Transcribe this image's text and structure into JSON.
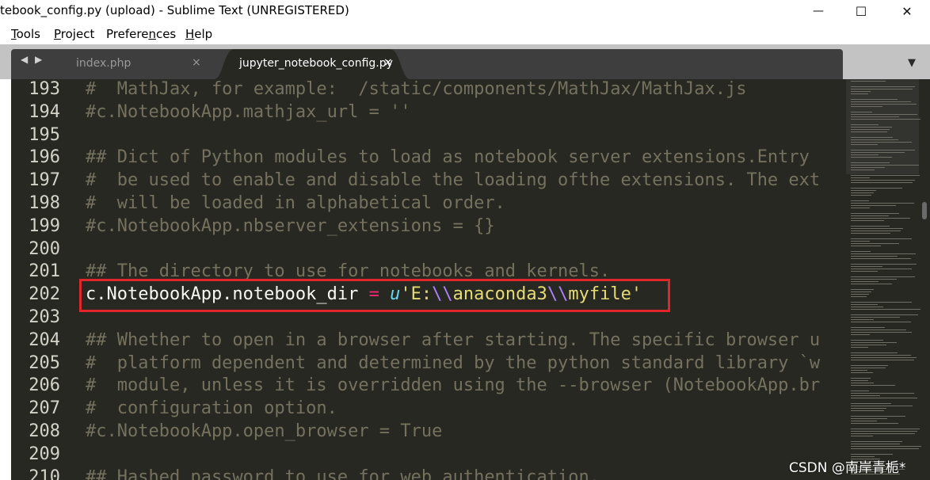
{
  "window": {
    "title": "tebook_config.py (upload) - Sublime Text (UNREGISTERED)",
    "minimize_glyph": "—",
    "maximize_glyph": "☐",
    "close_glyph": "✕"
  },
  "menu": [
    {
      "accel": "T",
      "rest": "ools"
    },
    {
      "accel": "P",
      "rest": "roject"
    },
    {
      "before": "Prefere",
      "accel": "n",
      "rest": "ces"
    },
    {
      "accel": "H",
      "rest": "elp"
    }
  ],
  "tabs": {
    "nav_left_glyph": "◀",
    "nav_right_glyph": "▶",
    "items": [
      {
        "label": "index.php",
        "close": "×",
        "active": false
      },
      {
        "label": "jupyter_notebook_config.py",
        "close": "×",
        "active": true
      }
    ],
    "menu_glyph": "▼"
  },
  "editor": {
    "lines": [
      {
        "num": "193",
        "text": "#  MathJax, for example:  /static/components/MathJax/MathJax.js"
      },
      {
        "num": "194",
        "text": "#c.NotebookApp.mathjax_url = ''"
      },
      {
        "num": "195",
        "text": ""
      },
      {
        "num": "196",
        "text": "## Dict of Python modules to load as notebook server extensions.Entry"
      },
      {
        "num": "197",
        "text": "#  be used to enable and disable the loading ofthe extensions. The ext"
      },
      {
        "num": "198",
        "text": "#  will be loaded in alphabetical order."
      },
      {
        "num": "199",
        "text": "#c.NotebookApp.nbserver_extensions = {}"
      },
      {
        "num": "200",
        "text": ""
      },
      {
        "num": "201",
        "text": "## The directory to use for notebooks and kernels."
      },
      {
        "num": "202",
        "text": ""
      },
      {
        "num": "203",
        "text": ""
      },
      {
        "num": "204",
        "text": "## Whether to open in a browser after starting. The specific browser u"
      },
      {
        "num": "205",
        "text": "#  platform dependent and determined by the python standard library `w"
      },
      {
        "num": "206",
        "text": "#  module, unless it is overridden using the --browser (NotebookApp.br"
      },
      {
        "num": "207",
        "text": "#  configuration option."
      },
      {
        "num": "208",
        "text": "#c.NotebookApp.open_browser = True"
      },
      {
        "num": "209",
        "text": ""
      },
      {
        "num": "210",
        "text": "## Hashed password to use for web authentication."
      }
    ],
    "active_line": {
      "prefix": "c.NotebookApp.notebook_dir ",
      "op": "=",
      "space": " ",
      "u": "u",
      "q1": "'E:",
      "esc1": "\\\\",
      "mid": "anaconda3",
      "esc2": "\\\\",
      "tail": "myfile'"
    }
  },
  "watermark": "CSDN @南岸青栀*",
  "colors": {
    "editor_bg": "#272822",
    "comment": "#75715e",
    "keyword": "#f92672",
    "string": "#e6db74",
    "escape": "#ae81ff",
    "highlight_box": "#e0262b"
  }
}
